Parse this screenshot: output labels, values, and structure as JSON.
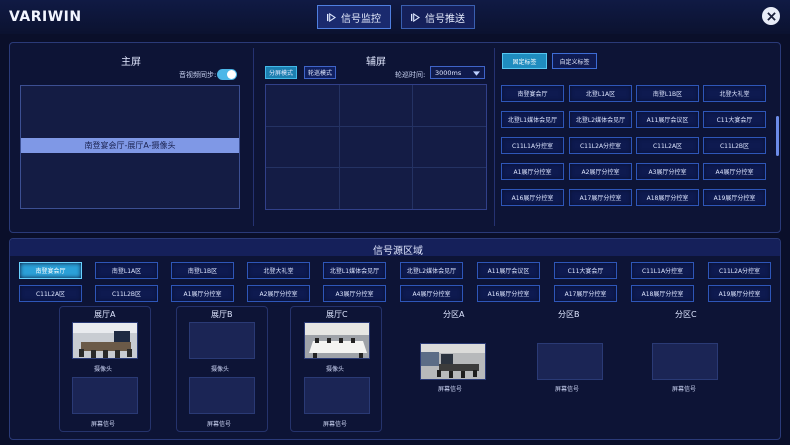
{
  "header": {
    "logo": "VARIWIN",
    "tabs": [
      {
        "label": "信号监控",
        "active": true
      },
      {
        "label": "信号推送",
        "active": false
      }
    ]
  },
  "main_screen": {
    "title": "主屏",
    "sync_label": "音视频同步:",
    "sync_enabled": true,
    "current_source": "南登宴会厅-展厅A-摄像头"
  },
  "aux_screen": {
    "title": "辅屏",
    "modes": [
      "分屏模式",
      "轮巡模式"
    ],
    "active_mode": "分屏模式",
    "interval_label": "轮巡时间:",
    "interval_value": "3000ms"
  },
  "tags": {
    "tabs": [
      "固定标签",
      "自定义标签"
    ],
    "items": [
      "南登宴会厅",
      "北登L1A区",
      "南登L1B区",
      "北登大礼堂",
      "北登L1媒体会见厅",
      "北登L2媒体会见厅",
      "A11展厅会议区",
      "C11大宴会厅",
      "C11L1A分控室",
      "C11L2A分控室",
      "C11L2A区",
      "C11L2B区",
      "A1展厅分控室",
      "A2展厅分控室",
      "A3展厅分控室",
      "A4展厅分控室",
      "A16展厅分控室",
      "A17展厅分控室",
      "A18展厅分控室",
      "A19展厅分控室"
    ]
  },
  "signal_area": {
    "title": "信号源区域",
    "buttons": [
      "南登宴会厅",
      "南登L1A区",
      "南登L1B区",
      "北登大礼堂",
      "北登L1媒体会见厅",
      "北登L2媒体会见厅",
      "A11展厅会议区",
      "C11大宴会厅",
      "C11L1A分控室",
      "C11L2A分控室",
      "C11L2A区",
      "C11L2B区",
      "A1展厅分控室",
      "A2展厅分控室",
      "A3展厅分控室",
      "A4展厅分控室",
      "A16展厅分控室",
      "A17展厅分控室",
      "A18展厅分控室",
      "A19展厅分控室"
    ],
    "halls": [
      {
        "title": "展厅A",
        "cam": "摄像头",
        "screen": "屏幕信号"
      },
      {
        "title": "展厅B",
        "cam": "摄像头",
        "screen": "屏幕信号"
      },
      {
        "title": "展厅C",
        "cam": "摄像头",
        "screen": "屏幕信号"
      }
    ],
    "zones": [
      {
        "title": "分区A",
        "screen": "屏幕信号"
      },
      {
        "title": "分区B",
        "screen": "屏幕信号"
      },
      {
        "title": "分区C",
        "screen": "屏幕信号"
      }
    ]
  },
  "colors": {
    "accent": "#2ba0d8",
    "background": "#0a0f2a"
  }
}
